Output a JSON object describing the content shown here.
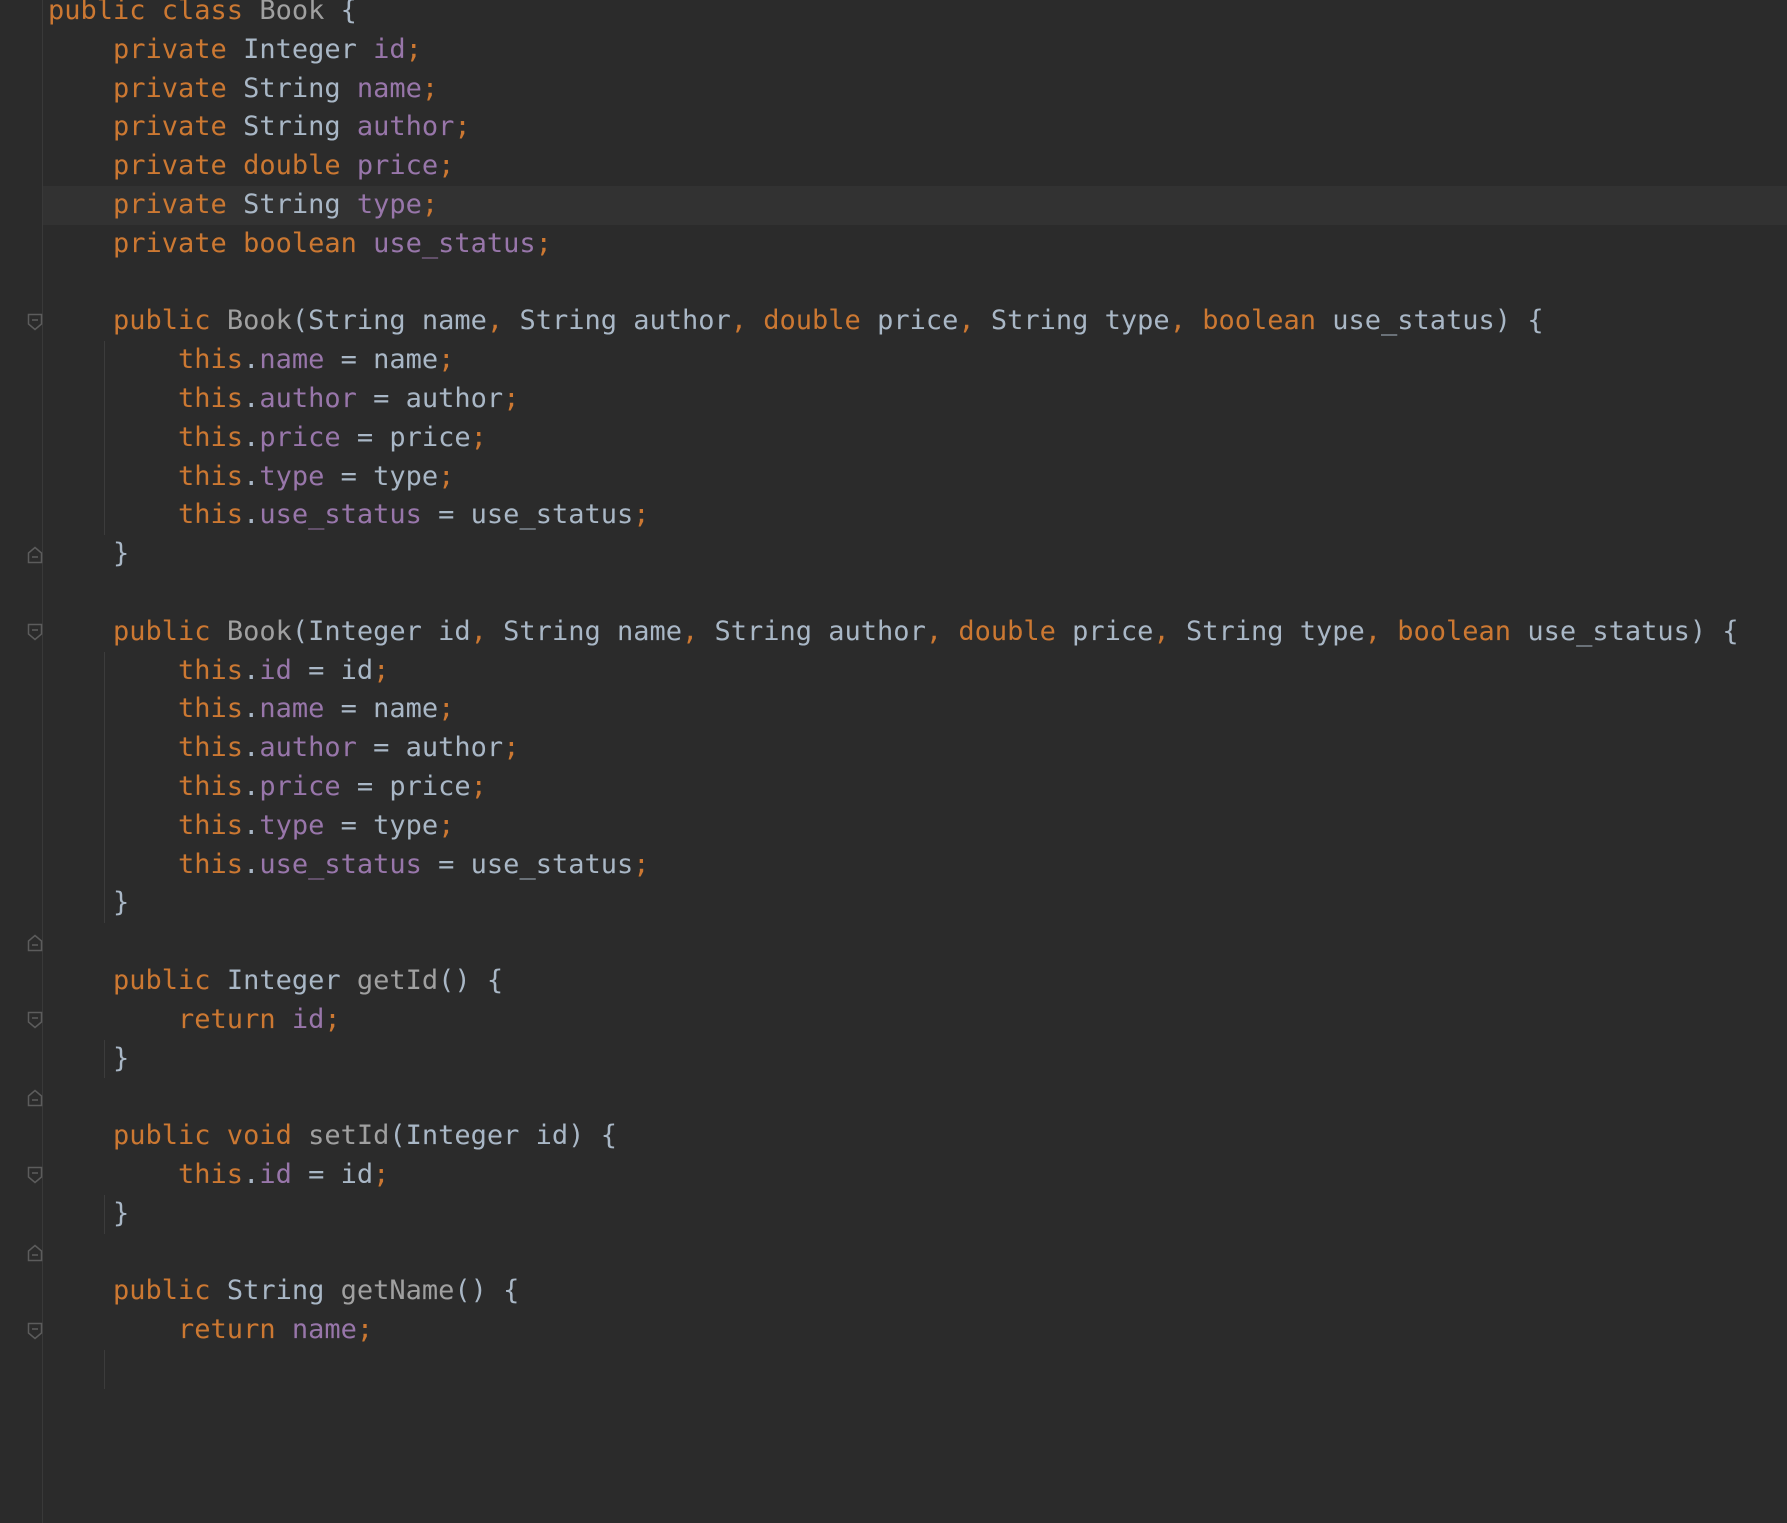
{
  "editor": {
    "language": "java",
    "current_line_index": 5,
    "colors": {
      "background": "#2b2b2b",
      "current_line": "#323232",
      "keyword": "#cc7832",
      "field": "#9876aa",
      "method": "#a0a0a0",
      "text": "#a9b7c6"
    },
    "lines": [
      [
        {
          "t": "public class ",
          "c": "kw"
        },
        {
          "t": "Book",
          "c": "fn"
        },
        {
          "t": " {",
          "c": "txt"
        }
      ],
      [
        {
          "t": "    private ",
          "c": "kw"
        },
        {
          "t": "Integer ",
          "c": "txt"
        },
        {
          "t": "id",
          "c": "field"
        },
        {
          "t": ";",
          "c": "punc"
        }
      ],
      [
        {
          "t": "    private ",
          "c": "kw"
        },
        {
          "t": "String ",
          "c": "txt"
        },
        {
          "t": "name",
          "c": "field"
        },
        {
          "t": ";",
          "c": "punc"
        }
      ],
      [
        {
          "t": "    private ",
          "c": "kw"
        },
        {
          "t": "String ",
          "c": "txt"
        },
        {
          "t": "author",
          "c": "field"
        },
        {
          "t": ";",
          "c": "punc"
        }
      ],
      [
        {
          "t": "    private double ",
          "c": "kw"
        },
        {
          "t": "price",
          "c": "field"
        },
        {
          "t": ";",
          "c": "punc"
        }
      ],
      [
        {
          "t": "    private ",
          "c": "kw"
        },
        {
          "t": "String ",
          "c": "txt"
        },
        {
          "t": "type",
          "c": "field"
        },
        {
          "t": ";",
          "c": "punc"
        }
      ],
      [
        {
          "t": "    private boolean ",
          "c": "kw"
        },
        {
          "t": "use_status",
          "c": "field"
        },
        {
          "t": ";",
          "c": "punc"
        }
      ],
      [],
      [
        {
          "t": "    public ",
          "c": "kw"
        },
        {
          "t": "Book",
          "c": "fn"
        },
        {
          "t": "(String name",
          "c": "txt"
        },
        {
          "t": ", ",
          "c": "punc"
        },
        {
          "t": "String author",
          "c": "txt"
        },
        {
          "t": ", ",
          "c": "punc"
        },
        {
          "t": "double ",
          "c": "kw"
        },
        {
          "t": "price",
          "c": "txt"
        },
        {
          "t": ", ",
          "c": "punc"
        },
        {
          "t": "String type",
          "c": "txt"
        },
        {
          "t": ", ",
          "c": "punc"
        },
        {
          "t": "boolean ",
          "c": "kw"
        },
        {
          "t": "use_status) {",
          "c": "txt"
        }
      ],
      [
        {
          "t": "        this",
          "c": "kw"
        },
        {
          "t": ".",
          "c": "txt"
        },
        {
          "t": "name",
          "c": "field"
        },
        {
          "t": " = name",
          "c": "txt"
        },
        {
          "t": ";",
          "c": "punc"
        }
      ],
      [
        {
          "t": "        this",
          "c": "kw"
        },
        {
          "t": ".",
          "c": "txt"
        },
        {
          "t": "author",
          "c": "field"
        },
        {
          "t": " = author",
          "c": "txt"
        },
        {
          "t": ";",
          "c": "punc"
        }
      ],
      [
        {
          "t": "        this",
          "c": "kw"
        },
        {
          "t": ".",
          "c": "txt"
        },
        {
          "t": "price",
          "c": "field"
        },
        {
          "t": " = price",
          "c": "txt"
        },
        {
          "t": ";",
          "c": "punc"
        }
      ],
      [
        {
          "t": "        this",
          "c": "kw"
        },
        {
          "t": ".",
          "c": "txt"
        },
        {
          "t": "type",
          "c": "field"
        },
        {
          "t": " = type",
          "c": "txt"
        },
        {
          "t": ";",
          "c": "punc"
        }
      ],
      [
        {
          "t": "        this",
          "c": "kw"
        },
        {
          "t": ".",
          "c": "txt"
        },
        {
          "t": "use_status",
          "c": "field"
        },
        {
          "t": " = use_status",
          "c": "txt"
        },
        {
          "t": ";",
          "c": "punc"
        }
      ],
      [
        {
          "t": "    }",
          "c": "txt"
        }
      ],
      [],
      [
        {
          "t": "    public ",
          "c": "kw"
        },
        {
          "t": "Book",
          "c": "fn"
        },
        {
          "t": "(Integer id",
          "c": "txt"
        },
        {
          "t": ", ",
          "c": "punc"
        },
        {
          "t": "String name",
          "c": "txt"
        },
        {
          "t": ", ",
          "c": "punc"
        },
        {
          "t": "String author",
          "c": "txt"
        },
        {
          "t": ", ",
          "c": "punc"
        },
        {
          "t": "double ",
          "c": "kw"
        },
        {
          "t": "price",
          "c": "txt"
        },
        {
          "t": ", ",
          "c": "punc"
        },
        {
          "t": "String type",
          "c": "txt"
        },
        {
          "t": ", ",
          "c": "punc"
        },
        {
          "t": "boolean ",
          "c": "kw"
        },
        {
          "t": "use_status) {",
          "c": "txt"
        }
      ],
      [
        {
          "t": "        this",
          "c": "kw"
        },
        {
          "t": ".",
          "c": "txt"
        },
        {
          "t": "id",
          "c": "field"
        },
        {
          "t": " = id",
          "c": "txt"
        },
        {
          "t": ";",
          "c": "punc"
        }
      ],
      [
        {
          "t": "        this",
          "c": "kw"
        },
        {
          "t": ".",
          "c": "txt"
        },
        {
          "t": "name",
          "c": "field"
        },
        {
          "t": " = name",
          "c": "txt"
        },
        {
          "t": ";",
          "c": "punc"
        }
      ],
      [
        {
          "t": "        this",
          "c": "kw"
        },
        {
          "t": ".",
          "c": "txt"
        },
        {
          "t": "author",
          "c": "field"
        },
        {
          "t": " = author",
          "c": "txt"
        },
        {
          "t": ";",
          "c": "punc"
        }
      ],
      [
        {
          "t": "        this",
          "c": "kw"
        },
        {
          "t": ".",
          "c": "txt"
        },
        {
          "t": "price",
          "c": "field"
        },
        {
          "t": " = price",
          "c": "txt"
        },
        {
          "t": ";",
          "c": "punc"
        }
      ],
      [
        {
          "t": "        this",
          "c": "kw"
        },
        {
          "t": ".",
          "c": "txt"
        },
        {
          "t": "type",
          "c": "field"
        },
        {
          "t": " = type",
          "c": "txt"
        },
        {
          "t": ";",
          "c": "punc"
        }
      ],
      [
        {
          "t": "        this",
          "c": "kw"
        },
        {
          "t": ".",
          "c": "txt"
        },
        {
          "t": "use_status",
          "c": "field"
        },
        {
          "t": " = use_status",
          "c": "txt"
        },
        {
          "t": ";",
          "c": "punc"
        }
      ],
      [
        {
          "t": "    }",
          "c": "txt"
        }
      ],
      [],
      [
        {
          "t": "    public ",
          "c": "kw"
        },
        {
          "t": "Integer ",
          "c": "txt"
        },
        {
          "t": "getId",
          "c": "fn"
        },
        {
          "t": "() {",
          "c": "txt"
        }
      ],
      [
        {
          "t": "        return ",
          "c": "kw"
        },
        {
          "t": "id",
          "c": "field"
        },
        {
          "t": ";",
          "c": "punc"
        }
      ],
      [
        {
          "t": "    }",
          "c": "txt"
        }
      ],
      [],
      [
        {
          "t": "    public void ",
          "c": "kw"
        },
        {
          "t": "setId",
          "c": "fn"
        },
        {
          "t": "(Integer id) {",
          "c": "txt"
        }
      ],
      [
        {
          "t": "        this",
          "c": "kw"
        },
        {
          "t": ".",
          "c": "txt"
        },
        {
          "t": "id",
          "c": "field"
        },
        {
          "t": " = id",
          "c": "txt"
        },
        {
          "t": ";",
          "c": "punc"
        }
      ],
      [
        {
          "t": "    }",
          "c": "txt"
        }
      ],
      [],
      [
        {
          "t": "    public ",
          "c": "kw"
        },
        {
          "t": "String ",
          "c": "txt"
        },
        {
          "t": "getName",
          "c": "fn"
        },
        {
          "t": "() {",
          "c": "txt"
        }
      ],
      [
        {
          "t": "        return ",
          "c": "kw"
        },
        {
          "t": "name",
          "c": "field"
        },
        {
          "t": ";",
          "c": "punc"
        }
      ]
    ],
    "fold_markers": [
      {
        "line": 8,
        "kind": "open"
      },
      {
        "line": 14,
        "kind": "close"
      },
      {
        "line": 16,
        "kind": "open"
      },
      {
        "line": 24,
        "kind": "close"
      },
      {
        "line": 26,
        "kind": "open"
      },
      {
        "line": 28,
        "kind": "close"
      },
      {
        "line": 30,
        "kind": "open"
      },
      {
        "line": 32,
        "kind": "close"
      },
      {
        "line": 34,
        "kind": "open"
      }
    ],
    "blocks": [
      {
        "from": 9,
        "to": 13
      },
      {
        "from": 17,
        "to": 23
      },
      {
        "from": 27,
        "to": 27
      },
      {
        "from": 31,
        "to": 31
      },
      {
        "from": 35,
        "to": 35
      }
    ]
  }
}
